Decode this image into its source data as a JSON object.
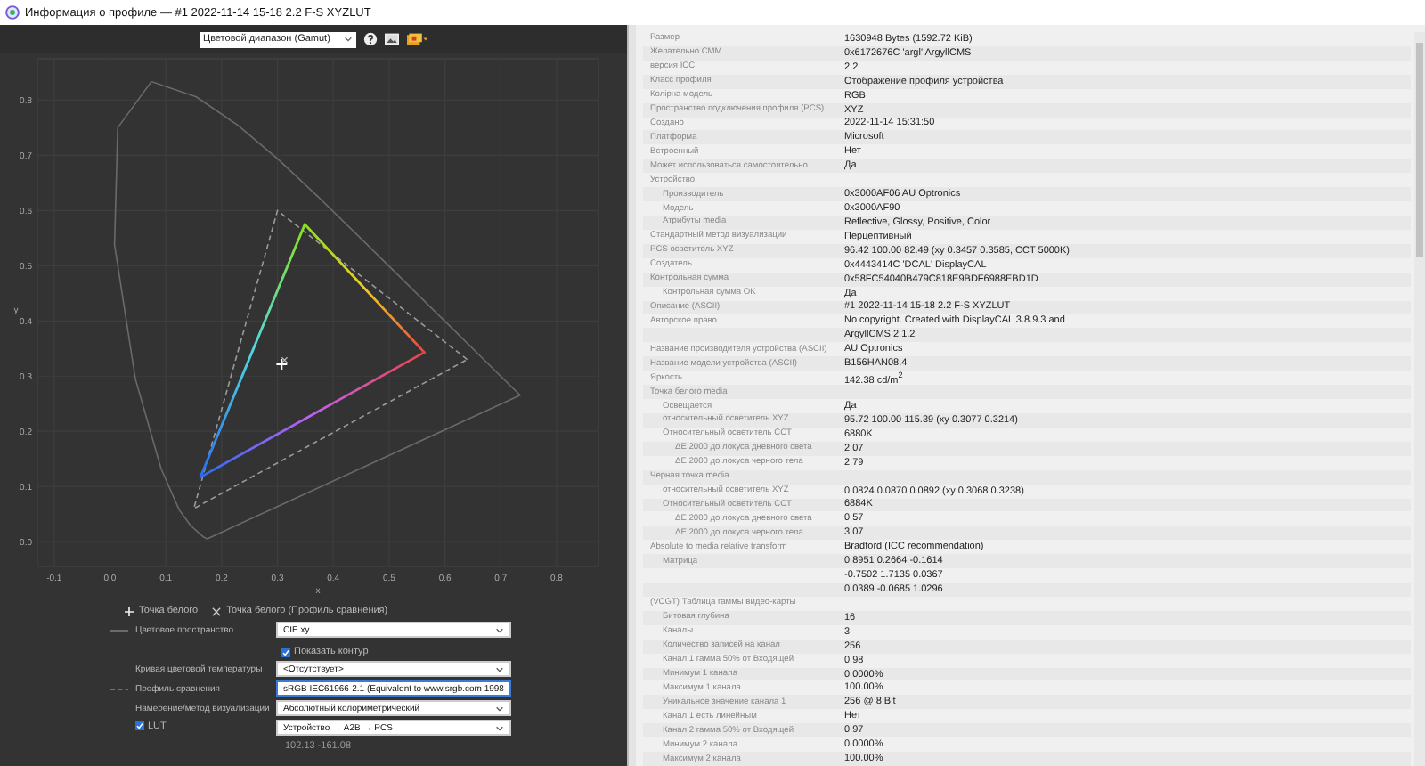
{
  "window": {
    "title": "Информация о профиле — #1 2022-11-14 15-18 2.2 F-S XYZLUT"
  },
  "toolbar": {
    "view_select": "Цветовой диапазон (Gamut)"
  },
  "plot": {
    "x_label": "x",
    "y_label": "y",
    "x_ticks": [
      "-0.1",
      "0.0",
      "0.1",
      "0.2",
      "0.3",
      "0.4",
      "0.5",
      "0.6",
      "0.7",
      "0.8"
    ],
    "y_ticks": [
      "0.8",
      "0.7",
      "0.6",
      "0.5",
      "0.4",
      "0.3",
      "0.2",
      "0.1",
      "0.0"
    ]
  },
  "legend": [
    {
      "kind": "plus",
      "label": "Точка белого"
    },
    {
      "kind": "cross",
      "label": "Точка белого (Профиль сравнения)"
    }
  ],
  "controls": [
    {
      "kind": "solid-line-select",
      "label": "Цветовое пространство",
      "value": "CIE xy",
      "focused": false
    },
    {
      "kind": "checkbox",
      "label": "Показать контур",
      "checked": true
    },
    {
      "kind": "select",
      "label": "Кривая цветовой температуры",
      "value": "<Отсутствует>",
      "focused": false
    },
    {
      "kind": "dashed-line-select",
      "label": "Профиль сравнения",
      "value": "sRGB IEC61966-2.1 (Equivalent to www.srgb.com 1998",
      "focused": true
    },
    {
      "kind": "select",
      "label": "Намерение/метод визуализации",
      "value": "Абсолютный колориметрический",
      "focused": false
    },
    {
      "kind": "checkbox-select",
      "label": "LUT",
      "checked": true,
      "value": "Устройство → A2B → PCS",
      "focused": false
    }
  ],
  "coordinates": "102.13 -161.08",
  "properties": [
    {
      "label": "Размер",
      "values": [
        "1630948 Bytes (1592.72 KiB)"
      ]
    },
    {
      "label": "Желательно CMM",
      "values": [
        "0x6172676C 'argl' ArgyllCMS"
      ]
    },
    {
      "label": "версия ICC",
      "values": [
        "2.2"
      ]
    },
    {
      "label": "Класс профиля",
      "values": [
        "Отображение профиля устройства"
      ]
    },
    {
      "label": "Колірна модель",
      "values": [
        "RGB"
      ]
    },
    {
      "label": "Пространство подключения профиля (PCS)",
      "values": [
        "XYZ"
      ]
    },
    {
      "label": "Создано",
      "values": [
        "2022-11-14 15:31:50"
      ]
    },
    {
      "label": "Платформа",
      "values": [
        "Microsoft"
      ]
    },
    {
      "label": "Встроенный",
      "values": [
        "Нет"
      ]
    },
    {
      "label": "Может использоваться самостоятельно",
      "values": [
        "Да"
      ]
    },
    {
      "label": "Устройство",
      "children": [
        {
          "label": "Производитель",
          "values": [
            "0x3000AF06 AU Optronics"
          ]
        },
        {
          "label": "Модель",
          "values": [
            "0x3000AF90"
          ]
        },
        {
          "label": "Атрибуты media",
          "values": [
            "Reflective, Glossy, Positive, Color"
          ]
        }
      ]
    },
    {
      "label": "Стандартный метод визуализации",
      "values": [
        "Перцептивный"
      ]
    },
    {
      "label": "PCS осветитель XYZ",
      "values": [
        "96.42 100.00 82.49 (xy 0.3457 0.3585, CCT 5000K)"
      ]
    },
    {
      "label": "Создатель",
      "values": [
        "0x4443414C 'DCAL' DisplayCAL"
      ]
    },
    {
      "label": "Контрольная сумма",
      "values": [
        "0x58FC54040B479C818E9BDF6988EBD1D"
      ],
      "children": [
        {
          "label": "Контрольная сумма OK",
          "values": [
            "Да"
          ]
        }
      ]
    },
    {
      "label": "Описание (ASCII)",
      "values": [
        "#1 2022-11-14 15-18 2.2 F-S XYZLUT"
      ]
    },
    {
      "label": "Авторское право",
      "values": [
        "No copyright. Created with DisplayCAL 3.8.9.3 and",
        "ArgyllCMS 2.1.2"
      ]
    },
    {
      "label": "Название производителя устройства (ASCII)",
      "values": [
        "AU Optronics"
      ]
    },
    {
      "label": "Название модели устройства (ASCII)",
      "values": [
        "B156HAN08.4"
      ]
    },
    {
      "label": "Яркость",
      "values": [
        "142.38 cd/m$^{2}$"
      ]
    },
    {
      "label": "Точка белого media",
      "children": [
        {
          "label": "Освещается",
          "values": [
            "Да"
          ]
        },
        {
          "label": "относительный осветитель XYZ",
          "values": [
            "95.72 100.00 115.39 (xy 0.3077 0.3214)"
          ]
        },
        {
          "label": "Относительный осветитель CCT",
          "values": [
            "6880K"
          ],
          "children": [
            {
              "label": "ΔE 2000 до локуса дневного света",
              "values": [
                "2.07"
              ]
            },
            {
              "label": "ΔE 2000 до локуса черного тела",
              "values": [
                "2.79"
              ]
            }
          ]
        }
      ]
    },
    {
      "label": "Черная точка media",
      "children": [
        {
          "label": "относительный осветитель XYZ",
          "values": [
            "0.0824 0.0870 0.0892 (xy 0.3068 0.3238)"
          ]
        },
        {
          "label": "Относительный осветитель CCT",
          "values": [
            "6884K"
          ],
          "children": [
            {
              "label": "ΔE 2000 до локуса дневного света",
              "values": [
                "0.57"
              ]
            },
            {
              "label": "ΔE 2000 до локуса черного тела",
              "values": [
                "3.07"
              ]
            }
          ]
        }
      ]
    },
    {
      "label": "Absolute to media relative transform",
      "values": [
        "Bradford (ICC recommendation)"
      ],
      "children": [
        {
          "label": "Матрица",
          "values": [
            "0.8951 0.2664 -0.1614",
            "-0.7502 1.7135 0.0367",
            "0.0389 -0.0685 1.0296"
          ]
        }
      ]
    },
    {
      "label": "(VCGT) Таблица гаммы видео-карты",
      "children": [
        {
          "label": "Битовая глубина",
          "values": [
            "16"
          ]
        },
        {
          "label": "Каналы",
          "values": [
            "3"
          ]
        },
        {
          "label": "Количество записей на канал",
          "values": [
            "256"
          ]
        },
        {
          "label": "Канал 1 гамма 50% от Входящей",
          "values": [
            "0.98"
          ]
        },
        {
          "label": "Минимум 1 канала",
          "values": [
            "0.0000%"
          ]
        },
        {
          "label": "Максимум 1 канала",
          "values": [
            "100.00%"
          ]
        },
        {
          "label": "Уникальное значение канала 1",
          "values": [
            "256 @ 8 Bit"
          ]
        },
        {
          "label": "Канал 1 есть линейным",
          "values": [
            "Нет"
          ]
        },
        {
          "label": "Канал 2 гамма 50% от Входящей",
          "values": [
            "0.97"
          ]
        },
        {
          "label": "Минимум 2 канала",
          "values": [
            "0.0000%"
          ]
        },
        {
          "label": "Максимум 2 канала",
          "values": [
            "100.00%"
          ]
        }
      ]
    }
  ]
}
